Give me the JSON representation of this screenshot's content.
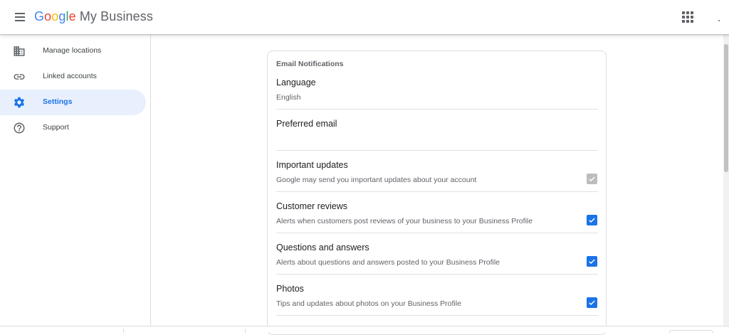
{
  "header": {
    "logo_google": [
      "G",
      "o",
      "o",
      "g",
      "l",
      "e"
    ],
    "logo_product": "My Business",
    "menu_icon": "hamburger-menu-icon",
    "apps_icon": "apps-grid-icon"
  },
  "sidebar": {
    "items": [
      {
        "label": "Manage locations",
        "icon": "building-icon",
        "active": false
      },
      {
        "label": "Linked accounts",
        "icon": "link-icon",
        "active": false
      },
      {
        "label": "Settings",
        "icon": "gear-icon",
        "active": true
      },
      {
        "label": "Support",
        "icon": "help-circle-icon",
        "active": false
      }
    ]
  },
  "card": {
    "title": "Email Notifications",
    "rows": [
      {
        "title": "Language",
        "subtitle": "English",
        "checkbox": null
      },
      {
        "title": "Preferred email",
        "subtitle": "",
        "checkbox": null
      },
      {
        "title": "Important updates",
        "subtitle": "Google may send you important updates about your account",
        "checkbox": "checked-disabled"
      },
      {
        "title": "Customer reviews",
        "subtitle": "Alerts when customers post reviews of your business to your Business Profile",
        "checkbox": "checked"
      },
      {
        "title": "Questions and answers",
        "subtitle": "Alerts about questions and answers posted to your Business Profile",
        "checkbox": "checked"
      },
      {
        "title": "Photos",
        "subtitle": "Tips and updates about photos on your Business Profile",
        "checkbox": "checked"
      }
    ]
  },
  "colors": {
    "accent": "#1a73e8",
    "active_bg": "#e8f0fe",
    "disabled_checkbox": "#bdbdbd",
    "google_blue": "#4285f4",
    "google_red": "#ea4335",
    "google_yellow": "#fbbc05",
    "google_green": "#34a853"
  }
}
